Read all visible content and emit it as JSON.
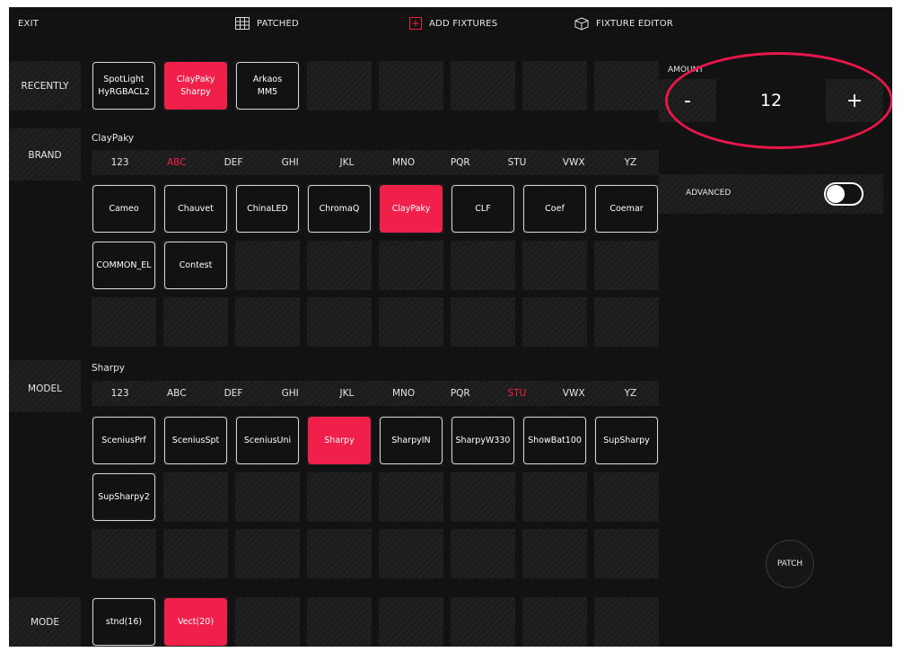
{
  "top_bar": {
    "exit_label": "EXIT",
    "patched_label": "PATCHED",
    "add_fixtures_label": "ADD FIXTURES",
    "fixture_editor_label": "FIXTURE EDITOR"
  },
  "sections": {
    "recently": "RECENTLY",
    "brand": "BRAND",
    "model": "MODEL",
    "mode": "MODE"
  },
  "recently": {
    "items": [
      {
        "label": "SpotLight\nHyRGBACL2",
        "active": false
      },
      {
        "label": "ClayPaky\nSharpy",
        "active": true
      },
      {
        "label": "Arkaos\nMM5",
        "active": false
      }
    ]
  },
  "brand": {
    "selected_name": "ClayPaky",
    "letters": [
      "123",
      "ABC",
      "DEF",
      "GHI",
      "JKL",
      "MNO",
      "PQR",
      "STU",
      "VWX",
      "YZ"
    ],
    "active_letter": "ABC",
    "items": [
      {
        "label": "Cameo",
        "active": false
      },
      {
        "label": "Chauvet",
        "active": false
      },
      {
        "label": "ChinaLED",
        "active": false
      },
      {
        "label": "ChromaQ",
        "active": false
      },
      {
        "label": "ClayPaky",
        "active": true
      },
      {
        "label": "CLF",
        "active": false
      },
      {
        "label": "Coef",
        "active": false
      },
      {
        "label": "Coemar",
        "active": false
      },
      {
        "label": "COMMON_EL",
        "active": false
      },
      {
        "label": "Contest",
        "active": false
      }
    ]
  },
  "model": {
    "selected_name": "Sharpy",
    "letters": [
      "123",
      "ABC",
      "DEF",
      "GHI",
      "JKL",
      "MNO",
      "PQR",
      "STU",
      "VWX",
      "YZ"
    ],
    "active_letter": "STU",
    "items": [
      {
        "label": "SceniusPrf",
        "active": false
      },
      {
        "label": "SceniusSpt",
        "active": false
      },
      {
        "label": "SceniusUni",
        "active": false
      },
      {
        "label": "Sharpy",
        "active": true
      },
      {
        "label": "SharpyIN",
        "active": false
      },
      {
        "label": "SharpyW330",
        "active": false
      },
      {
        "label": "ShowBat100",
        "active": false
      },
      {
        "label": "SupSharpy",
        "active": false
      },
      {
        "label": "SupSharpy2",
        "active": false
      }
    ]
  },
  "mode": {
    "items": [
      {
        "label": "stnd(16)",
        "active": false
      },
      {
        "label": "Vect(20)",
        "active": true
      }
    ]
  },
  "amount": {
    "label": "AMOUNT",
    "minus": "-",
    "value": "12",
    "plus": "+"
  },
  "advanced": {
    "label": "ADVANCED",
    "enabled": true
  },
  "patch_label": "PATCH",
  "colors": {
    "accent": "#f0204a",
    "background": "#121212",
    "annotation": "#e8174a"
  }
}
